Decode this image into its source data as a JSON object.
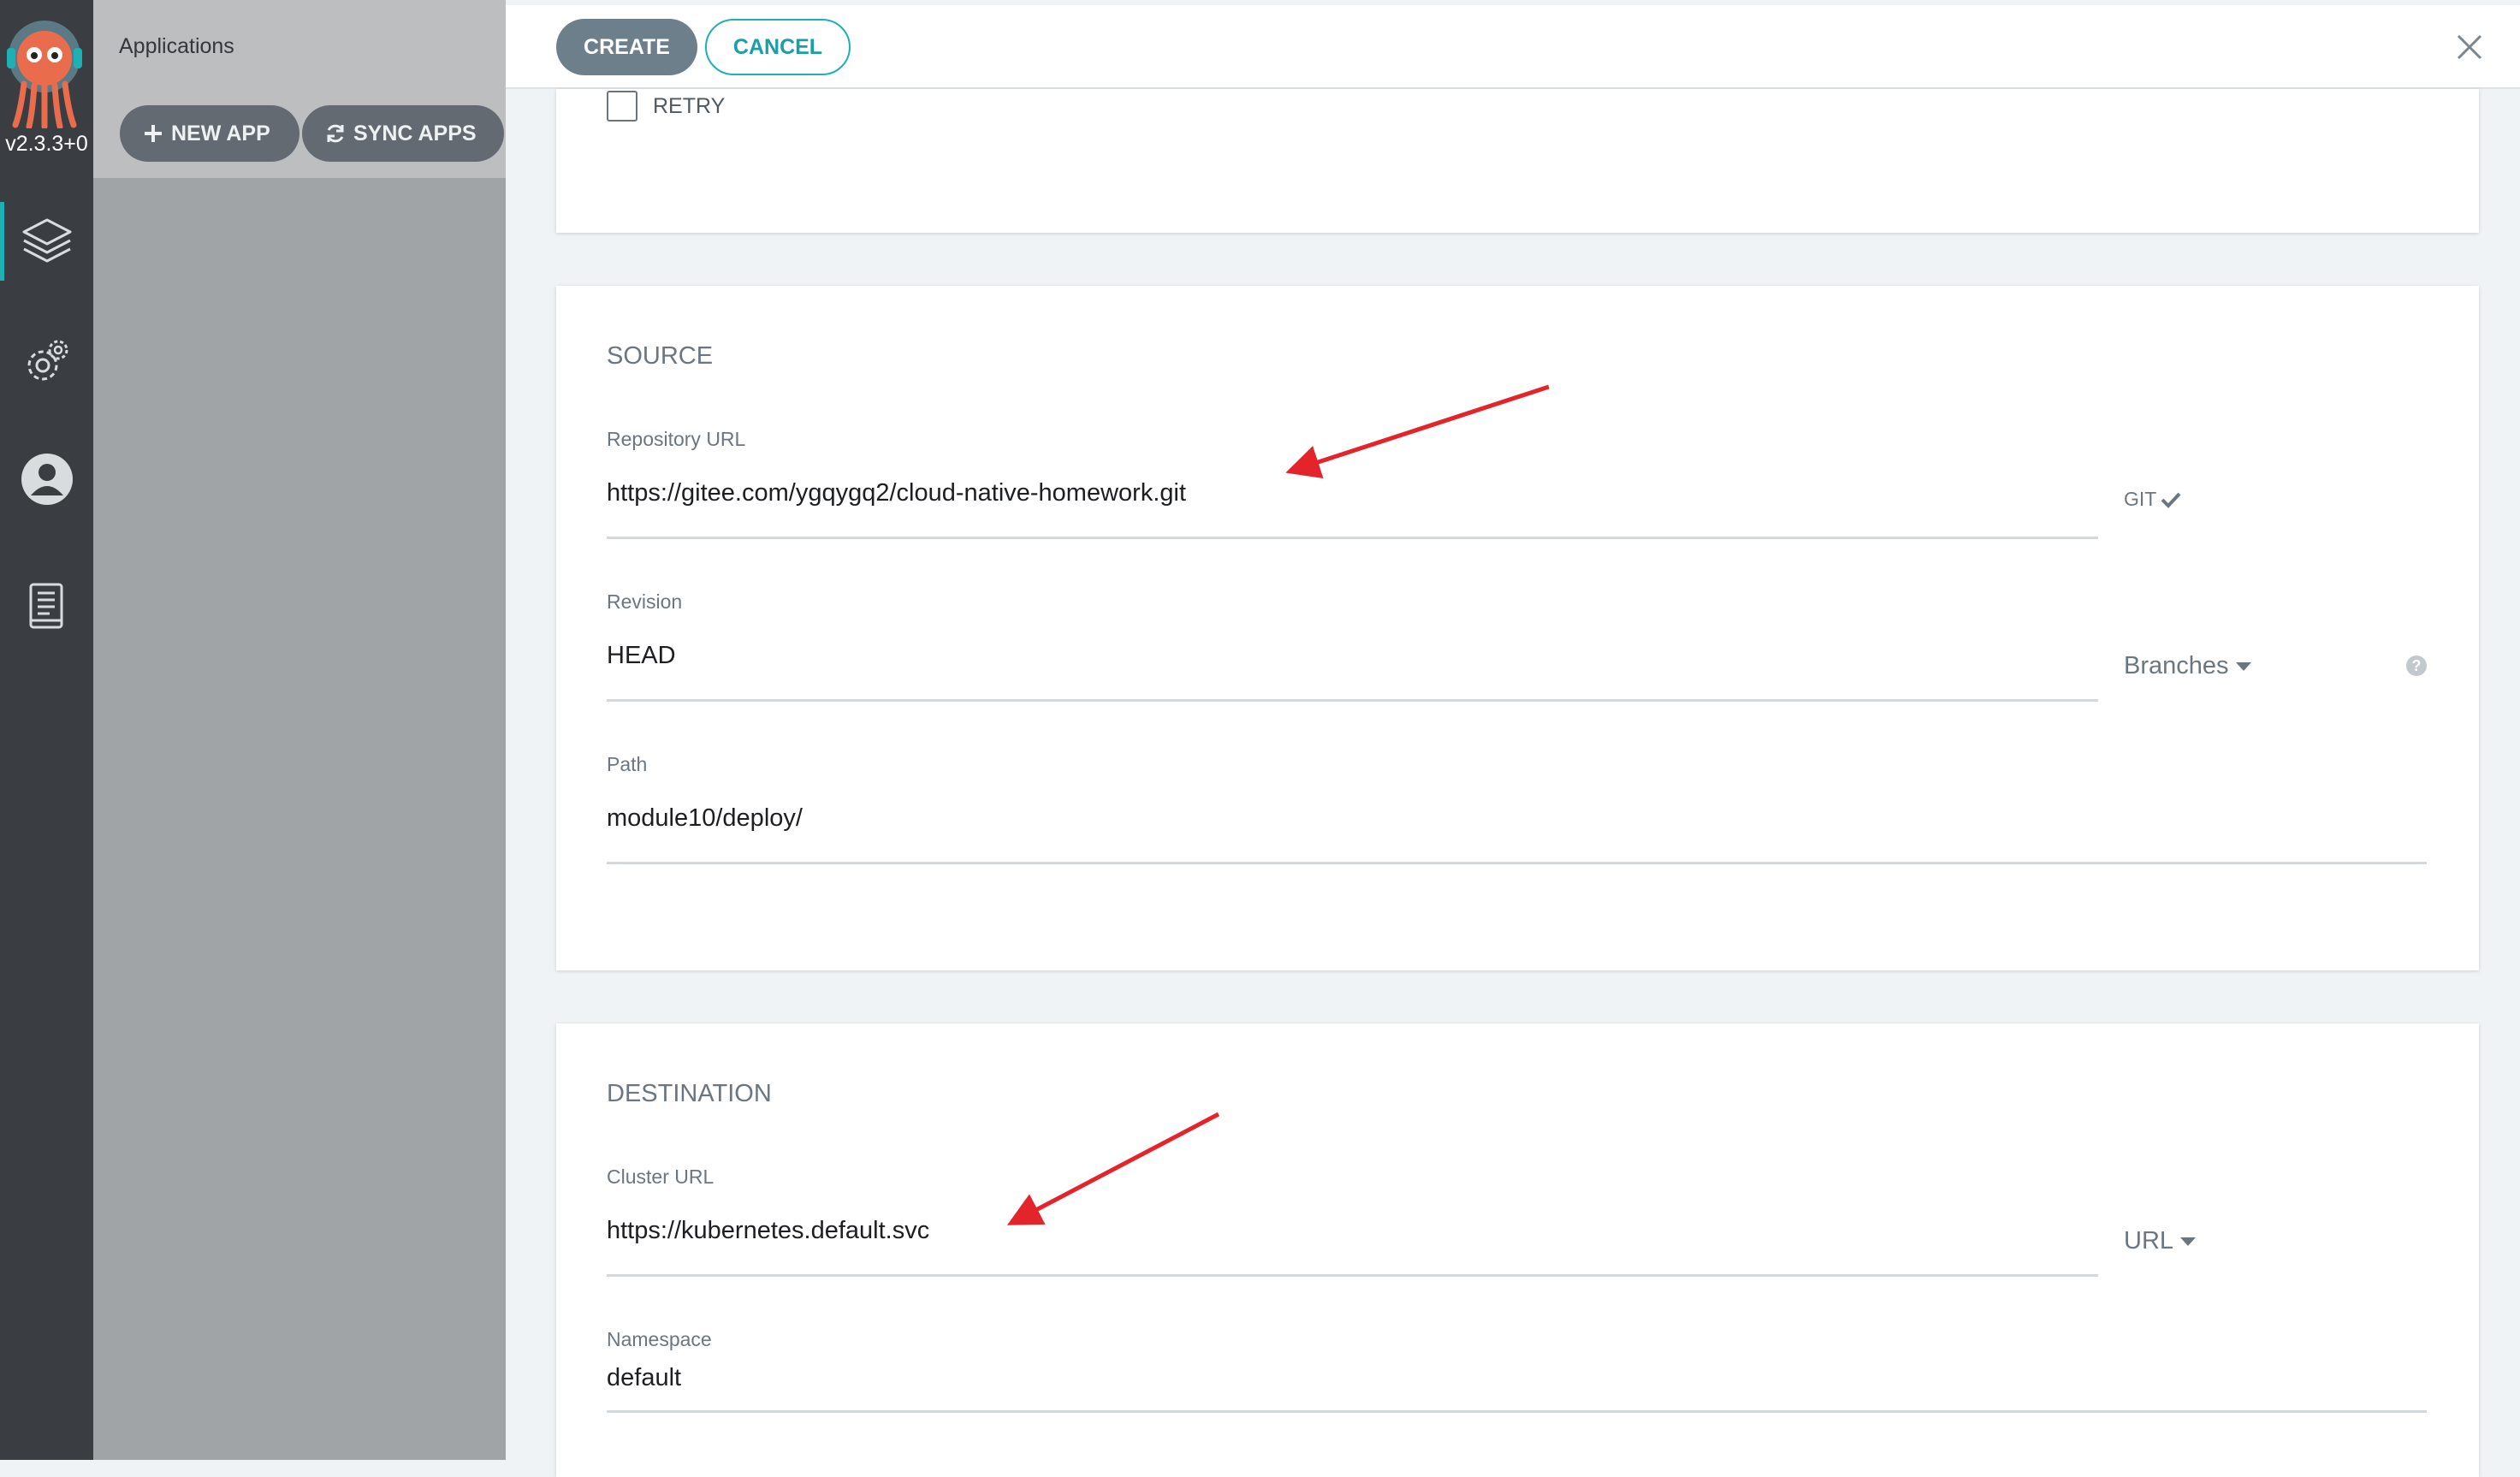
{
  "sidebar": {
    "version": "v2.3.3+0",
    "nav": [
      {
        "icon": "layers-icon"
      },
      {
        "icon": "gear-icon"
      },
      {
        "icon": "user-icon"
      },
      {
        "icon": "docs-icon"
      }
    ]
  },
  "apps_panel": {
    "title": "Applications",
    "new_app": "NEW APP",
    "sync_apps": "SYNC APPS"
  },
  "header": {
    "create": "CREATE",
    "cancel": "CANCEL"
  },
  "sync_options": {
    "retry_label": "RETRY",
    "retry_checked": false
  },
  "source": {
    "title": "SOURCE",
    "repo_label": "Repository URL",
    "repo_value": "https://gitee.com/ygqygq2/cloud-native-homework.git",
    "repo_type": "GIT",
    "revision_label": "Revision",
    "revision_value": "HEAD",
    "revision_mode": "Branches",
    "path_label": "Path",
    "path_value": "module10/deploy/"
  },
  "destination": {
    "title": "DESTINATION",
    "cluster_label": "Cluster URL",
    "cluster_value": "https://kubernetes.default.svc",
    "cluster_mode": "URL",
    "namespace_label": "Namespace",
    "namespace_value": "default"
  },
  "colors": {
    "accent": "#1fb0b4",
    "sidebar": "#3a3d41",
    "annotation_arrow": "#e3242b"
  }
}
